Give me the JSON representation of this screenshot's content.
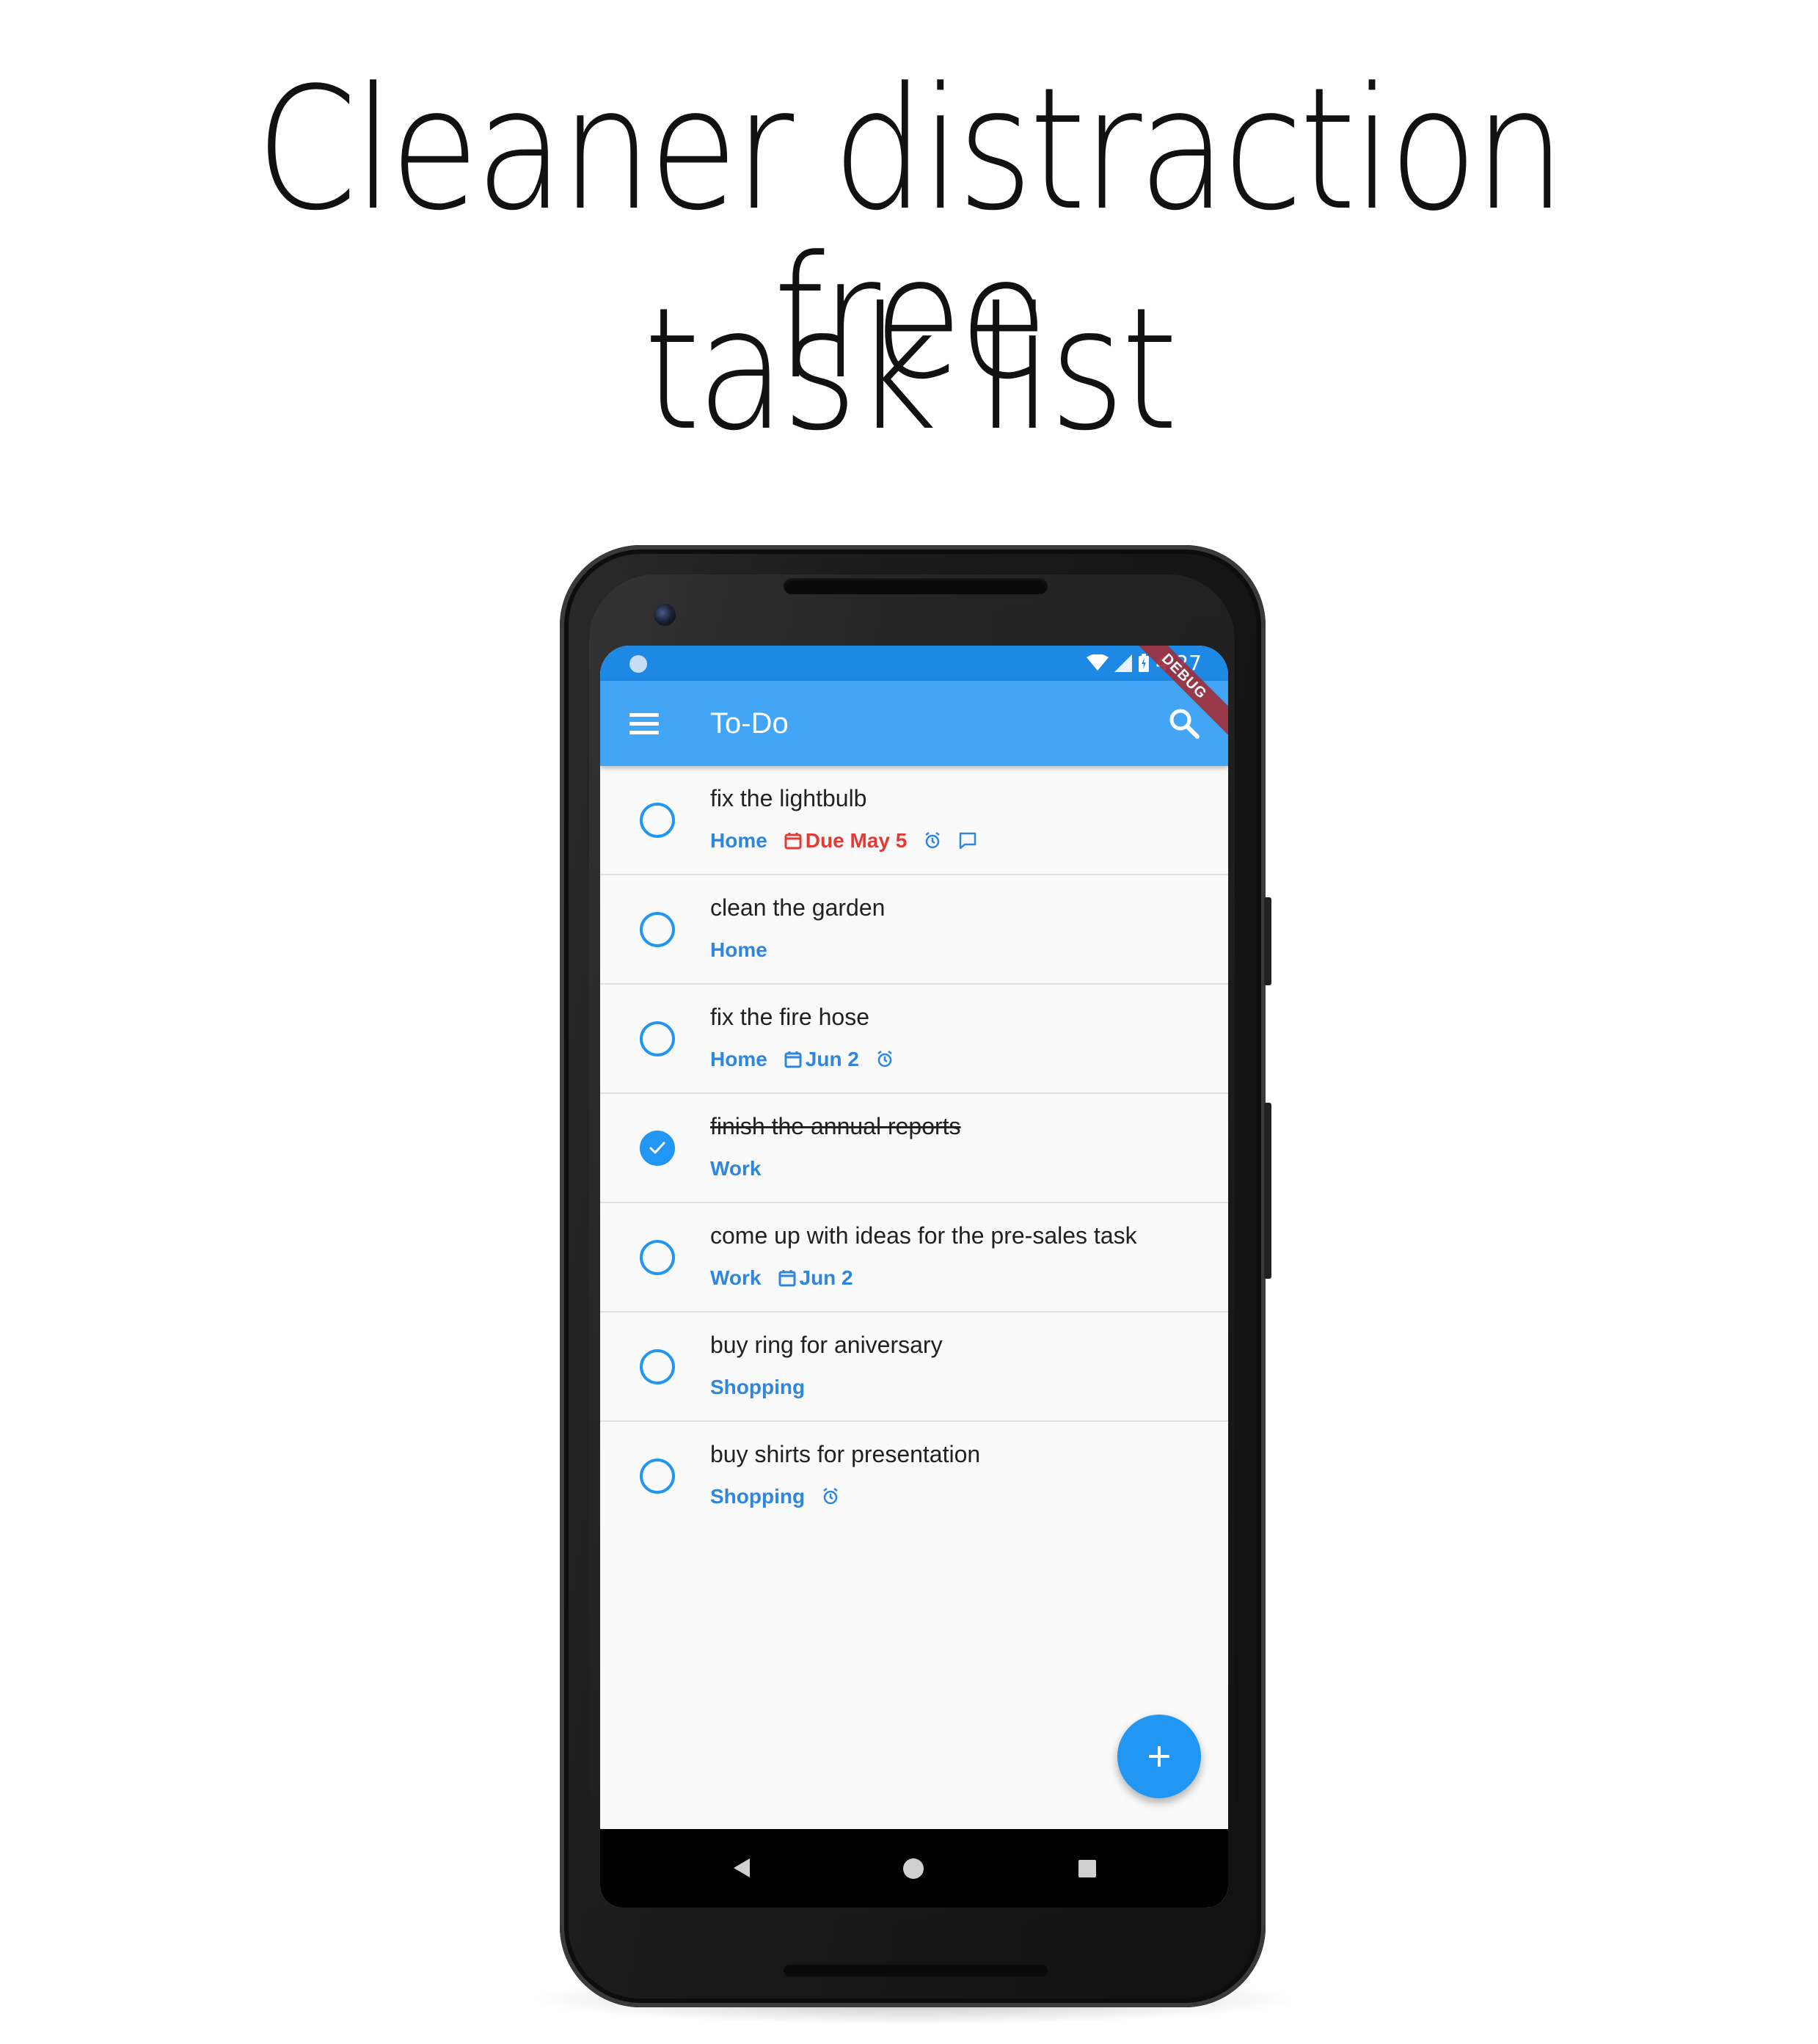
{
  "headline": {
    "line1": "Cleaner distraction free",
    "line2": "task list"
  },
  "status_bar": {
    "time": "4:27"
  },
  "debug_banner": "DEBUG",
  "app_bar": {
    "title": "To-Do"
  },
  "colors": {
    "accent": "#2196f3",
    "app_bar": "#42a5f5",
    "status_bar": "#1e88e5",
    "due_overdue": "#e53935",
    "category": "#2e86de"
  },
  "tasks": [
    {
      "title": "fix the lightbulb",
      "category": "Home",
      "date": "Due May 5",
      "date_color": "red",
      "has_alarm": true,
      "has_note": true,
      "done": false
    },
    {
      "title": "clean the garden",
      "category": "Home",
      "date": "",
      "has_alarm": false,
      "has_note": false,
      "done": false
    },
    {
      "title": "fix the fire hose",
      "category": "Home",
      "date": "Jun 2",
      "date_color": "blue",
      "has_alarm": true,
      "has_note": false,
      "done": false
    },
    {
      "title": "finish the annual reports",
      "category": "Work",
      "date": "",
      "has_alarm": false,
      "has_note": false,
      "done": true
    },
    {
      "title": "come up with ideas for the pre-sales task",
      "category": "Work",
      "date": "Jun 2",
      "date_color": "blue",
      "has_alarm": false,
      "has_note": false,
      "done": false
    },
    {
      "title": "buy ring for aniversary",
      "category": "Shopping",
      "date": "",
      "has_alarm": false,
      "has_note": false,
      "done": false
    },
    {
      "title": "buy shirts for presentation",
      "category": "Shopping",
      "date": "",
      "has_alarm": true,
      "has_note": false,
      "done": false
    }
  ],
  "icons": {
    "menu": "menu-icon",
    "search": "search-icon",
    "add": "add-icon",
    "calendar": "calendar-icon",
    "alarm": "alarm-icon",
    "note": "comment-icon",
    "check": "check-icon"
  }
}
